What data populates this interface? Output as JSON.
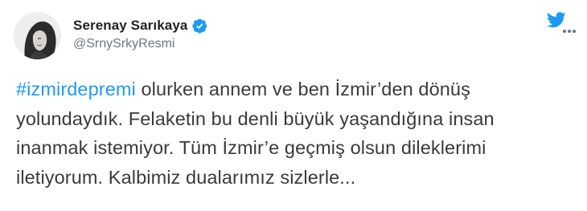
{
  "user": {
    "display_name": "Serenay Sarıkaya",
    "handle": "@SrnySrkyResmi",
    "verified": true
  },
  "tweet": {
    "hashtag": "#izmirdepremi",
    "lines": [
      " olurken annem ve ben İzmir’den dönüş",
      "yolundaydık. Felaketin bu denli büyük yaşandığına insan",
      "inanmak istemiyor. Tüm İzmir’e geçmiş olsun dileklerimi",
      "iletiyorum. Kalbimiz dualarımız sizlerle..."
    ]
  },
  "icons": {
    "twitter_logo": "twitter-bird-icon",
    "more": "more-horizontal-icon",
    "verified": "verified-badge-icon"
  },
  "colors": {
    "accent": "#1d9bf0",
    "text": "#3a3a3a",
    "secondary": "#6b7780"
  }
}
